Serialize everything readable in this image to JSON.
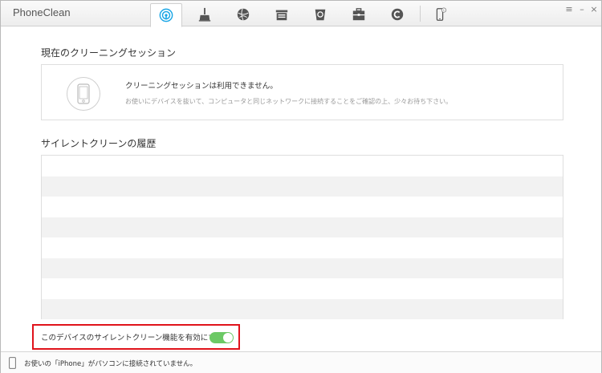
{
  "app": {
    "title": "PhoneClean"
  },
  "toolbar": {
    "tools": [
      {
        "name": "silent-clean-icon",
        "active": true
      },
      {
        "name": "quick-clean-icon",
        "active": false
      },
      {
        "name": "internet-clean-icon",
        "active": false
      },
      {
        "name": "privacy-clean-icon",
        "active": false
      },
      {
        "name": "system-clean-icon",
        "active": false
      },
      {
        "name": "toolbox-icon",
        "active": false
      },
      {
        "name": "premium-icon",
        "active": false
      }
    ],
    "device_badge": "1"
  },
  "window_controls": {
    "menu": "≡",
    "minimize": "–",
    "close": "×"
  },
  "session": {
    "heading": "現在のクリーニングセッション",
    "message": "クリーニングセッションは利用できません。",
    "hint": "お使いにデバイスを抜いて、コンピュータと同じネットワークに接続することをご確認の上、少々お待ち下さい。"
  },
  "history": {
    "heading": "サイレントクリーンの履歴",
    "rows": 8
  },
  "silent_clean_toggle": {
    "label": "このデバイスのサイレントクリーン機能を有効にする",
    "enabled": true,
    "on_color": "#6cc965"
  },
  "status": {
    "text": "お使いの「iPhone」がパソコンに接続されていません。"
  },
  "colors": {
    "highlight": "#e0131b",
    "accent": "#1aa6e6"
  }
}
